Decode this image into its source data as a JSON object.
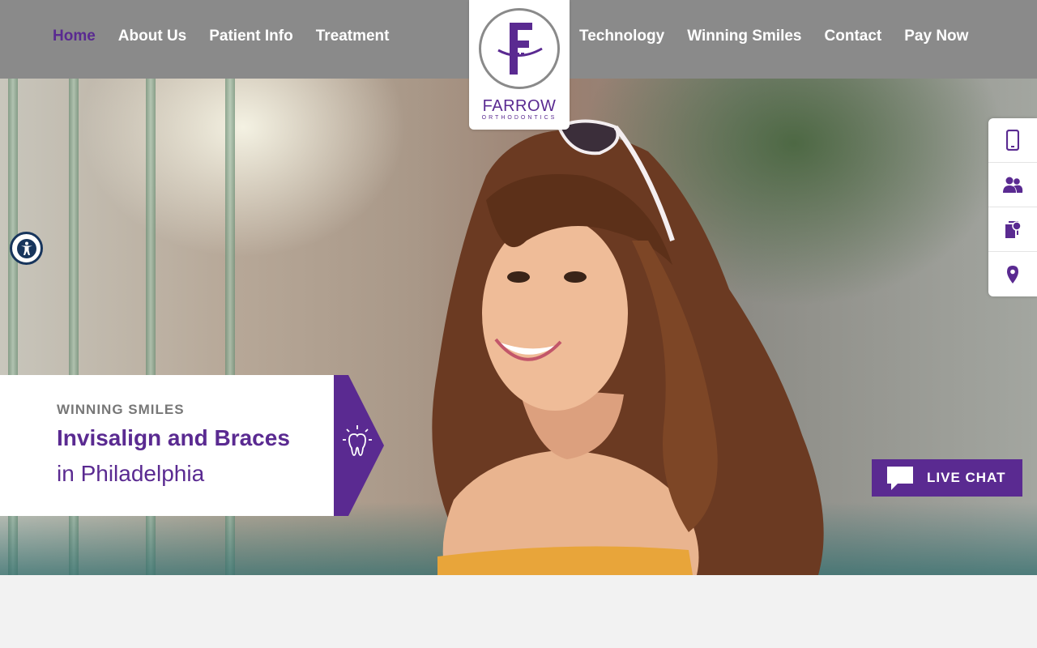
{
  "nav": {
    "left": [
      "Home",
      "About Us",
      "Patient Info",
      "Treatment"
    ],
    "right": [
      "Technology",
      "Winning Smiles",
      "Contact",
      "Pay Now"
    ]
  },
  "logo": {
    "name": "FARROW",
    "sub": "ORTHODONTICS"
  },
  "hero": {
    "eyebrow": "WINNING SMILES",
    "title": "Invisalign and Braces",
    "subtitle": "in Philadelphia",
    "badge_icon": "tooth-icon"
  },
  "sidebar": {
    "icons": [
      "phone-icon",
      "patients-icon",
      "forms-icon",
      "location-icon"
    ]
  },
  "chat": {
    "label": "LIVE CHAT",
    "icon": "chat-bubble-icon"
  },
  "colors": {
    "brand": "#5a2a91",
    "header": "#8a8a8a",
    "a11y": "#17355c"
  }
}
